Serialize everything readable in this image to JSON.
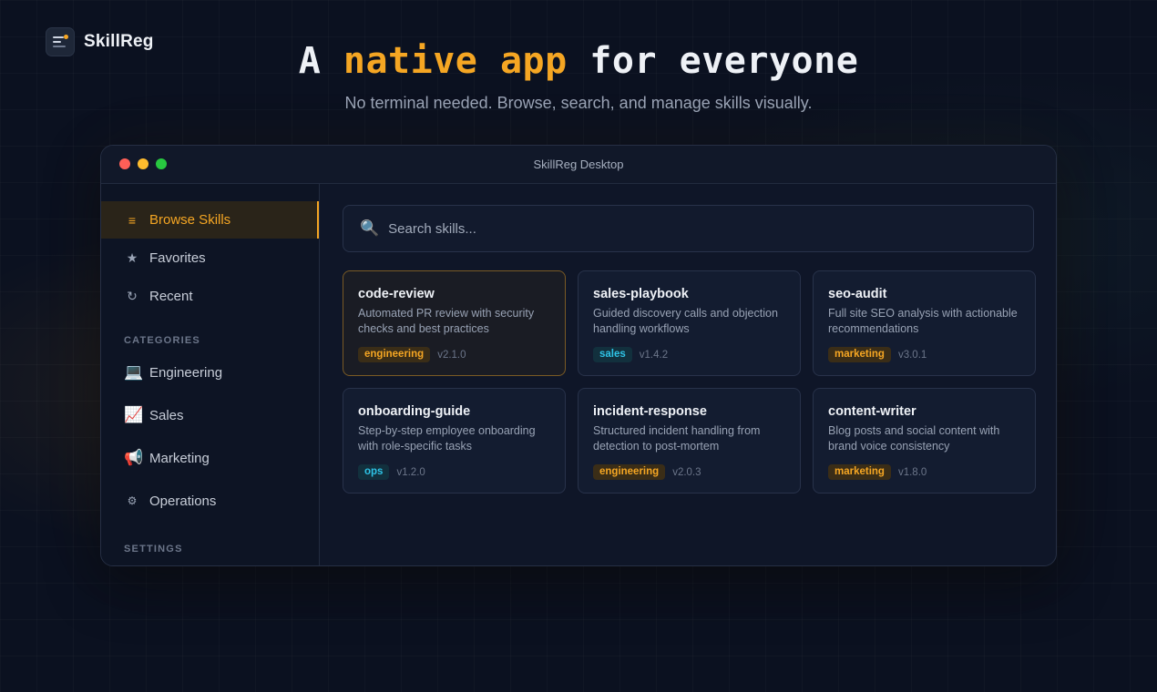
{
  "brand": {
    "name": "SkillReg"
  },
  "hero": {
    "title_pre": "A ",
    "title_accent": "native app",
    "title_post": " for everyone",
    "subtitle": "No terminal needed. Browse, search, and manage skills visually."
  },
  "window": {
    "title": "SkillReg Desktop"
  },
  "sidebar": {
    "nav": [
      {
        "label": "Browse Skills",
        "icon": "list-icon",
        "glyph": "≡",
        "active": true
      },
      {
        "label": "Favorites",
        "icon": "star-icon",
        "glyph": "★"
      },
      {
        "label": "Recent",
        "icon": "refresh-icon",
        "glyph": "↻"
      }
    ],
    "categories_heading": "CATEGORIES",
    "categories": [
      {
        "label": "Engineering",
        "icon": "laptop-icon",
        "glyph": "💻"
      },
      {
        "label": "Sales",
        "icon": "chart-icon",
        "glyph": "📈"
      },
      {
        "label": "Marketing",
        "icon": "megaphone-icon",
        "glyph": "📢"
      },
      {
        "label": "Operations",
        "icon": "gear-icon",
        "glyph": "⚙"
      }
    ],
    "settings_heading": "SETTINGS"
  },
  "search": {
    "placeholder": "Search skills..."
  },
  "skills": [
    {
      "name": "code-review",
      "desc": "Automated PR review with security checks and best practices",
      "tag": "engineering",
      "tag_color": "#f5a623",
      "version": "v2.1.0"
    },
    {
      "name": "sales-playbook",
      "desc": "Guided discovery calls and objection handling workflows",
      "tag": "sales",
      "tag_color": "#2ec3e6",
      "version": "v1.4.2"
    },
    {
      "name": "seo-audit",
      "desc": "Full site SEO analysis with actionable recommendations",
      "tag": "marketing",
      "tag_color": "#f5a623",
      "version": "v3.0.1"
    },
    {
      "name": "onboarding-guide",
      "desc": "Step-by-step employee onboarding with role-specific tasks",
      "tag": "ops",
      "tag_color": "#2ec3e6",
      "version": "v1.2.0"
    },
    {
      "name": "incident-response",
      "desc": "Structured incident handling from detection to post-mortem",
      "tag": "engineering",
      "tag_color": "#f5a623",
      "version": "v2.0.3"
    },
    {
      "name": "content-writer",
      "desc": "Blog posts and social content with brand voice consistency",
      "tag": "marketing",
      "tag_color": "#f5a623",
      "version": "v1.8.0"
    }
  ],
  "colors": {
    "accent": "#f5a623",
    "teal": "#2ec3e6",
    "background": "#0b1120"
  }
}
